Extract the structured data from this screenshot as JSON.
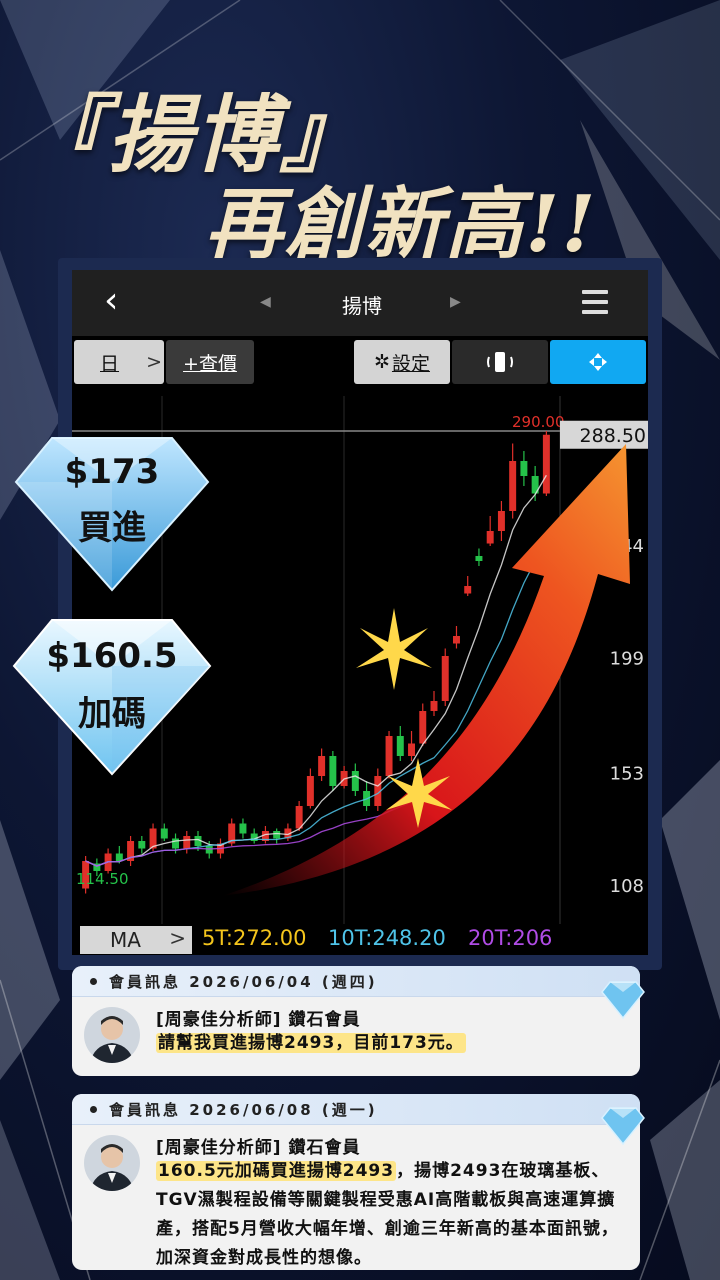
{
  "headline": {
    "line1": "『揚博』",
    "line2": "再創新高!!"
  },
  "app": {
    "back_icon": "chevron-left-icon",
    "title": "揚博",
    "prev_icon": "triangle-left-icon",
    "next_icon": "triangle-right-icon",
    "menu_icon": "hamburger-icon"
  },
  "toolbar": {
    "period_label": "日",
    "period_chevron": ">",
    "quote_label": "+查價",
    "settings_label": "設定",
    "settings_icon": "gear-icon"
  },
  "chart_data": {
    "type": "candlestick",
    "high_marker": "290.00",
    "last_price": "288.50",
    "low_marker": "114.50",
    "y_ticks": [
      "244",
      "199",
      "153",
      "108"
    ],
    "ylim": [
      100,
      300
    ],
    "candles": [
      [
        107,
        118,
        105,
        120
      ],
      [
        117,
        114,
        112,
        119
      ],
      [
        114,
        121,
        113,
        123
      ],
      [
        121,
        118,
        117,
        124
      ],
      [
        118,
        126,
        116,
        128
      ],
      [
        126,
        123,
        121,
        128
      ],
      [
        123,
        131,
        122,
        133
      ],
      [
        131,
        127,
        126,
        133
      ],
      [
        127,
        123,
        121,
        129
      ],
      [
        123,
        128,
        121,
        130
      ],
      [
        128,
        124,
        122,
        130
      ],
      [
        124,
        121,
        119,
        126
      ],
      [
        121,
        125,
        119,
        127
      ],
      [
        125,
        133,
        124,
        135
      ],
      [
        133,
        129,
        127,
        135
      ],
      [
        129,
        126,
        125,
        131
      ],
      [
        126,
        130,
        125,
        132
      ],
      [
        130,
        127,
        125,
        131
      ],
      [
        127,
        131,
        126,
        133
      ],
      [
        131,
        140,
        130,
        142
      ],
      [
        140,
        152,
        139,
        155
      ],
      [
        152,
        160,
        150,
        163
      ],
      [
        160,
        148,
        146,
        162
      ],
      [
        148,
        154,
        147,
        156
      ],
      [
        154,
        146,
        144,
        157
      ],
      [
        146,
        140,
        138,
        150
      ],
      [
        140,
        152,
        138,
        155
      ],
      [
        152,
        168,
        151,
        170
      ],
      [
        168,
        160,
        158,
        172
      ],
      [
        160,
        165,
        158,
        170
      ],
      [
        165,
        178,
        164,
        181
      ],
      [
        178,
        182,
        176,
        186
      ],
      [
        182,
        200,
        180,
        203
      ],
      [
        205,
        208,
        203,
        212
      ],
      [
        225,
        228,
        224,
        232
      ],
      [
        240,
        238,
        236,
        243
      ],
      [
        245,
        250,
        244,
        256
      ],
      [
        250,
        258,
        246,
        262
      ],
      [
        258,
        278,
        255,
        285
      ],
      [
        278,
        272,
        268,
        282
      ],
      [
        272,
        265,
        262,
        276
      ],
      [
        265,
        288.5,
        264,
        290
      ]
    ],
    "ma": [
      {
        "name": "5T",
        "value": "272.00",
        "color": "#f4c51c"
      },
      {
        "name": "10T",
        "value": "248.20",
        "color": "#4fc3e8"
      },
      {
        "name": "20T",
        "value": "206",
        "color": "#b04ce6"
      }
    ]
  },
  "ma_bar": {
    "label": "MA",
    "chevron": ">"
  },
  "badges": {
    "buy": {
      "price": "$173",
      "label": "買進"
    },
    "add": {
      "price": "$160.5",
      "label": "加碼"
    }
  },
  "cards": [
    {
      "header": "會員訊息 2026/06/04 (週四)",
      "author": "[周豪佳分析師] 鑽石會員",
      "highlight": "請幫我買進揚博2493，目前173元。",
      "rest": ""
    },
    {
      "header": "會員訊息 2026/06/08 (週一)",
      "author": "[周豪佳分析師] 鑽石會員",
      "highlight": "160.5元加碼買進揚博2493",
      "rest": "，揚博2493在玻璃基板、TGV濕製程設備等關鍵製程受惠AI高階載板與高速運算擴產，搭配5月營收大幅年增、創逾三年新高的基本面訊號，加深資金對成長性的想像。"
    }
  ],
  "colors": {
    "up": "#e0302a",
    "down": "#25c24a",
    "accent_blue": "#11a8f2",
    "gold": "#f1e2c0"
  }
}
